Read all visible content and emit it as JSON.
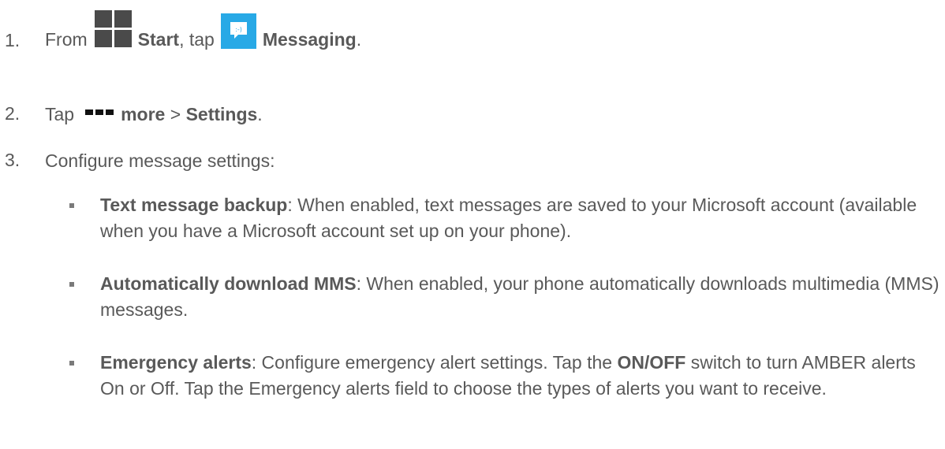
{
  "steps": [
    {
      "number": "1.",
      "from": "From",
      "start_label": "Start",
      "comma_tap": ", tap",
      "messaging_label": "Messaging",
      "period": "."
    },
    {
      "number": "2.",
      "tap": "Tap",
      "more_label": "more",
      "separator": ">",
      "settings_label": "Settings",
      "period": "."
    },
    {
      "number": "3.",
      "text": "Configure message settings:"
    }
  ],
  "bullets": [
    {
      "title": "Text message backup",
      "body": ": When enabled, text messages are saved to your Microsoft account (available when you have a Microsoft account set up on your phone)."
    },
    {
      "title": "Automatically download MMS",
      "body": ": When enabled, your phone automatically downloads multimedia (MMS) messages."
    },
    {
      "title": "Emergency alerts",
      "body_a": ": Configure emergency alert settings. Tap the ",
      "onoff": "ON/OFF",
      "body_b": " switch to turn AMBER alerts On or Off. Tap the Emergency alerts field to choose the types of alerts you want to receive."
    }
  ],
  "icons": {
    "start": "windows-start-icon",
    "messaging": "messaging-icon",
    "more": "more-dots-icon"
  },
  "colors": {
    "text": "#595959",
    "messaging_tile": "#28a9e6"
  }
}
